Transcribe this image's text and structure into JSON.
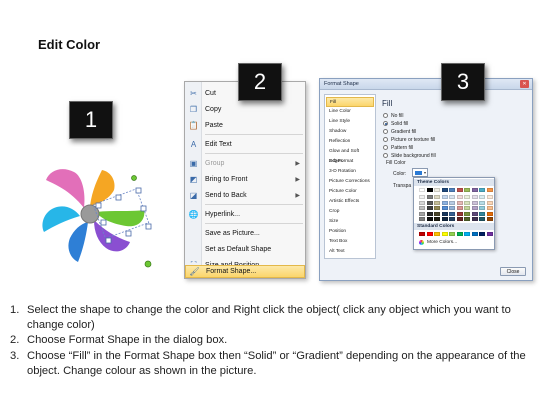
{
  "title": "Edit Color",
  "steps": [
    "1",
    "2",
    "3"
  ],
  "context_menu": {
    "items": [
      {
        "label": "Cut",
        "icon": "scissors-icon"
      },
      {
        "label": "Copy",
        "icon": "copy-icon"
      },
      {
        "label": "Paste",
        "icon": "paste-icon"
      },
      {
        "label": "Edit Text",
        "icon": "edit-text-icon"
      },
      {
        "label": "Group",
        "icon": "group-icon"
      },
      {
        "label": "Bring to Front",
        "icon": "bring-front-icon"
      },
      {
        "label": "Send to Back",
        "icon": "send-back-icon"
      },
      {
        "label": "Hyperlink...",
        "icon": "hyperlink-icon"
      },
      {
        "label": "Save as Picture...",
        "icon": ""
      },
      {
        "label": "Set as Default Shape",
        "icon": ""
      },
      {
        "label": "Size and Position...",
        "icon": "size-position-icon"
      },
      {
        "label": "Format Shape...",
        "icon": "format-shape-icon"
      }
    ]
  },
  "dialog": {
    "title": "Format Shape",
    "close_x": "✕",
    "categories": [
      "Fill",
      "Line Color",
      "Line Style",
      "Shadow",
      "Reflection",
      "Glow and Soft Edges",
      "3-D Format",
      "3-D Rotation",
      "Picture Corrections",
      "Picture Color",
      "Artistic Effects",
      "Crop",
      "Size",
      "Position",
      "Text Box",
      "Alt Text"
    ],
    "panel_title": "Fill",
    "fill_options": [
      "No fill",
      "Solid fill",
      "Gradient fill",
      "Picture or texture fill",
      "Pattern fill",
      "Slide background fill"
    ],
    "selected_option": "Solid fill",
    "fill_color_label": "Fill Color",
    "color_label": "Color:",
    "transparency_label": "Transpa",
    "close_label": "Close"
  },
  "color_popup": {
    "theme_header": "Theme Colors",
    "standard_header": "Standard Colors",
    "more_colors": "More Colors...",
    "theme_top_row": [
      "#ffffff",
      "#000000",
      "#eeece1",
      "#1f497d",
      "#4f81bd",
      "#c0504d",
      "#9bbb59",
      "#8064a2",
      "#4bacc6",
      "#f79646"
    ],
    "theme_shade_rows": [
      [
        "#f2f2f2",
        "#7f7f7f",
        "#ddd9c3",
        "#c6d9f0",
        "#dbe5f1",
        "#f2dcdb",
        "#ebf1dd",
        "#e5e0ec",
        "#dbeef3",
        "#fdeada"
      ],
      [
        "#d8d8d8",
        "#595959",
        "#c4bd97",
        "#8db3e2",
        "#b8cce4",
        "#e5b9b7",
        "#d7e3bc",
        "#ccc1d9",
        "#b7dde8",
        "#fbd5b5"
      ],
      [
        "#bfbfbf",
        "#3f3f3f",
        "#938953",
        "#548dd4",
        "#95b3d7",
        "#d99694",
        "#c3d69b",
        "#b2a2c7",
        "#92cddc",
        "#fac08f"
      ],
      [
        "#a5a5a5",
        "#262626",
        "#494429",
        "#17365d",
        "#366092",
        "#953734",
        "#76923c",
        "#5f497a",
        "#31859b",
        "#e36c09"
      ],
      [
        "#7f7f7f",
        "#0c0c0c",
        "#1d1b10",
        "#0f243e",
        "#244061",
        "#632423",
        "#4f6128",
        "#3f3151",
        "#205867",
        "#974806"
      ]
    ],
    "standard_row": [
      "#c00000",
      "#ff0000",
      "#ffc000",
      "#ffff00",
      "#92d050",
      "#00b050",
      "#00b0f0",
      "#0070c0",
      "#002060",
      "#7030a0"
    ]
  },
  "instructions": [
    {
      "num": "1.",
      "text": "Select the shape to change the color and Right click the object( click any object which you want to change color)"
    },
    {
      "num": "2.",
      "text": "Choose Format Shape in the dialog box."
    },
    {
      "num": "3.",
      "text": "Choose “Fill” in the Format Shape box then “Solid” or “Gradient” depending on the appearance of the object. Change colour as shown in the picture."
    }
  ],
  "pinwheel_colors": {
    "pink": "#e26fb9",
    "orange": "#f5a623",
    "cyan": "#27b6e8",
    "green": "#6cc733",
    "blue": "#2e7fd6",
    "purple": "#8a4fd1",
    "hub": "#9a9a9a"
  }
}
